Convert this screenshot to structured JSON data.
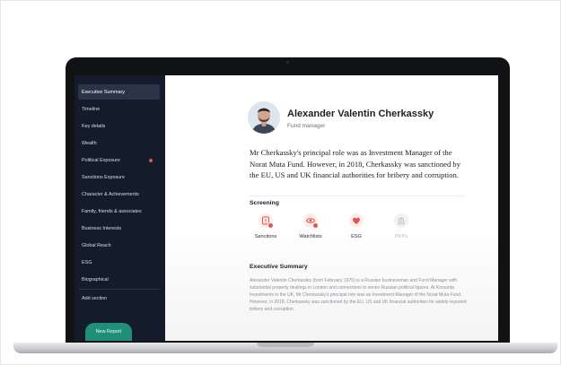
{
  "sidebar": {
    "items": [
      {
        "label": "Executive Summary",
        "active": true
      },
      {
        "label": "Timeline"
      },
      {
        "label": "Key details"
      },
      {
        "label": "Wealth"
      },
      {
        "label": "Political Exposure",
        "alert": true
      },
      {
        "label": "Sanctions Exposure"
      },
      {
        "label": "Character & Achievements"
      },
      {
        "label": "Family, friends & associates"
      },
      {
        "label": "Business Interests"
      },
      {
        "label": "Global Reach"
      },
      {
        "label": "ESG"
      },
      {
        "label": "Biographical"
      }
    ],
    "add_section": "Add section",
    "new_report": "New Report"
  },
  "profile": {
    "name": "Alexander Valentin Cherkassky",
    "role": "Fund manager",
    "bio": "Mr Cherkassky's principal role was as Investment Manager of the Norat Muta Fund. However, in 2018, Cherkassky was sanctioned by the EU, US and UK financial authorities for bribery and corruption."
  },
  "screening": {
    "title": "Screening",
    "items": [
      {
        "label": "Sanctions",
        "icon": "alert-icon",
        "flagged": true
      },
      {
        "label": "Watchlists",
        "icon": "eye-icon",
        "flagged": true
      },
      {
        "label": "ESG",
        "icon": "heart-icon",
        "flagged": false
      },
      {
        "label": "PEPs",
        "icon": "building-icon",
        "flagged": false
      }
    ]
  },
  "executive_summary": {
    "title": "Executive Summary",
    "text": "Alexander Valentin Cherkassky (born February 1975) is a Russian businessman and Fund Manager with substantial property dealings in London and connections to senior Russian political figures. At Korsanta Investments in the UK, Mr Cherkassky's principal role was as Investment Manager of the Norat Muta Fund. However, in 2018, Cherkassky was sanctioned by the EU, US and UK financial authorities for widely-reported bribery and corruption."
  },
  "colors": {
    "sidebar_bg": "#141c2c",
    "alert_red": "#e0574f",
    "new_report_green": "#1f8f7a"
  }
}
